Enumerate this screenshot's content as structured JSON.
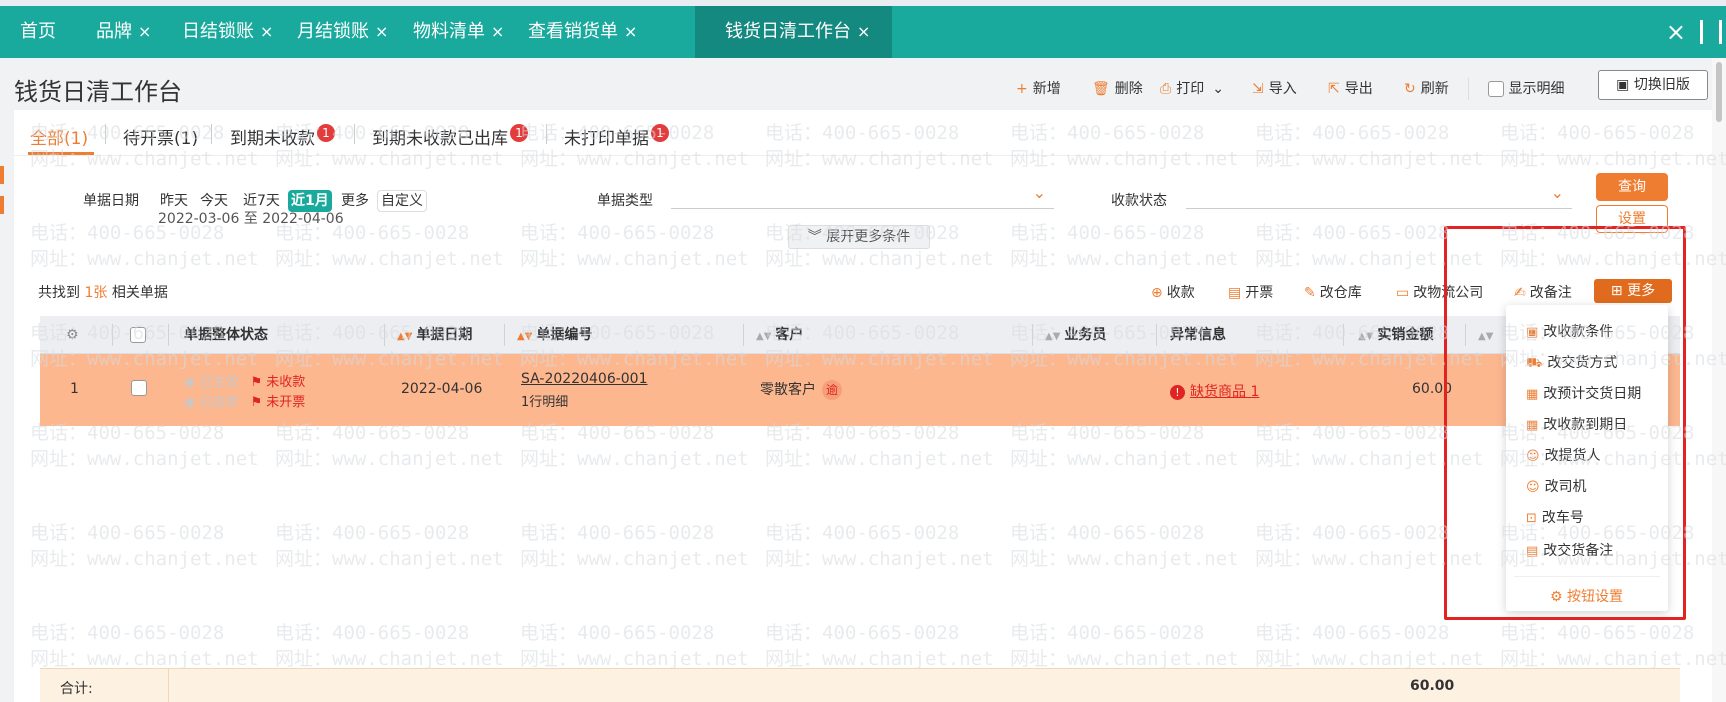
{
  "tabs": [
    {
      "label": "首页",
      "closable": false
    },
    {
      "label": "品牌",
      "closable": true
    },
    {
      "label": "日结锁账",
      "closable": true
    },
    {
      "label": "月结锁账",
      "closable": true
    },
    {
      "label": "物料清单",
      "closable": true
    },
    {
      "label": "查看销货单",
      "closable": true
    },
    {
      "label": "钱货日清工作台",
      "closable": true,
      "active": true
    }
  ],
  "close_glyph": "×",
  "window": {
    "close_glyph": "×"
  },
  "page_title": "钱货日清工作台",
  "toolbar": {
    "new": "新增",
    "delete": "删除",
    "print": "打印",
    "import": "导入",
    "export": "导出",
    "refresh": "刷新",
    "show_detail": "显示明细",
    "switch_old": "切换旧版"
  },
  "filter_tabs": [
    {
      "label": "全部(1)",
      "active": true,
      "badge": ""
    },
    {
      "label": "待开票(1)",
      "active": false,
      "badge": ""
    },
    {
      "label": "到期未收款",
      "active": false,
      "badge": "1"
    },
    {
      "label": "到期未收款已出库",
      "active": false,
      "badge": "1"
    },
    {
      "label": "未打印单据",
      "active": false,
      "badge": "1"
    }
  ],
  "filters": {
    "date_label": "单据日期",
    "date_chips": [
      {
        "label": "昨天",
        "on": false
      },
      {
        "label": "今天",
        "on": false
      },
      {
        "label": "近7天",
        "on": false
      },
      {
        "label": "近1月",
        "on": true
      },
      {
        "label": "更多",
        "on": false
      },
      {
        "label": "自定义",
        "on": false
      }
    ],
    "date_range": "2022-03-06 至 2022-04-06",
    "type_label": "单据类型",
    "type_value": "",
    "receipt_label": "收款状态",
    "receipt_value": "",
    "query_btn": "查询",
    "settings_btn": "设置",
    "expand_more": "展开更多条件"
  },
  "grid": {
    "found_prefix": "共找到",
    "found_count": "1张",
    "found_suffix": "相关单据",
    "actions": {
      "receive": "收款",
      "invoice": "开票",
      "warehouse": "改仓库",
      "logistics": "改物流公司",
      "remark": "改备注",
      "more": "更多"
    },
    "columns": [
      "单据整体状态",
      "单据日期",
      "单据编号",
      "客户",
      "业务员",
      "异常信息",
      "实销金额"
    ],
    "rows": [
      {
        "index": "1",
        "status": [
          {
            "grey": "已生效",
            "red": "未收款"
          },
          {
            "grey": "已出库",
            "red": "未开票"
          }
        ],
        "date": "2022-04-06",
        "code": "SA-20220406-001",
        "code_sub": "1行明细",
        "customer": "零散客户",
        "customer_badge": "逾",
        "salesperson": "",
        "exception": "缺货商品 1",
        "amount": "60.00"
      }
    ],
    "total_label": "合计:",
    "total_amount": "60.00"
  },
  "more_menu": {
    "items": [
      "改收款条件",
      "改交货方式",
      "改预计交货日期",
      "改收款到期日",
      "改提货人",
      "改司机",
      "改车号",
      "改交货备注"
    ],
    "button_settings": "按钮设置"
  },
  "watermark": {
    "phone": "电话：400-665-0028",
    "site": "网址：www.chanjet.net"
  },
  "colors": {
    "primary": "#19aa9d",
    "accent": "#ef7d31",
    "highlight_row": "#fcb78f",
    "danger": "#e02424"
  }
}
